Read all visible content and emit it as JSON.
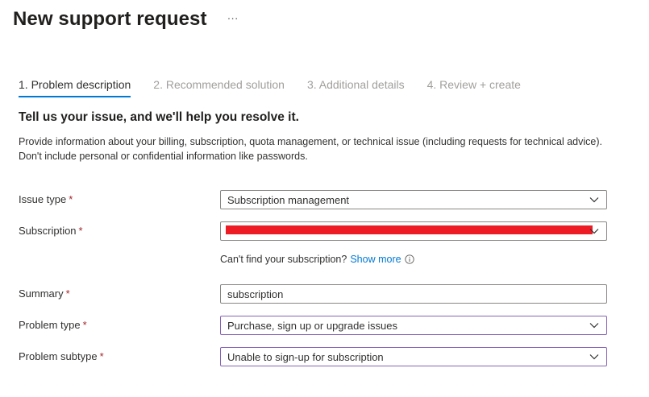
{
  "page": {
    "title": "New support request",
    "more_label": "···"
  },
  "tabs": [
    {
      "label": "1. Problem description",
      "active": true
    },
    {
      "label": "2. Recommended solution",
      "active": false
    },
    {
      "label": "3. Additional details",
      "active": false
    },
    {
      "label": "4. Review + create",
      "active": false
    }
  ],
  "intro": {
    "heading": "Tell us your issue, and we'll help you resolve it.",
    "description": "Provide information about your billing, subscription, quota management, or technical issue (including requests for technical advice). Don't include personal or confidential information like passwords."
  },
  "form": {
    "required_marker": "*",
    "issue_type": {
      "label": "Issue type",
      "value": "Subscription management"
    },
    "subscription": {
      "label": "Subscription",
      "value_redacted": true
    },
    "subscription_hint": {
      "text": "Can't find your subscription?",
      "link": "Show more",
      "icon": "info-icon"
    },
    "summary": {
      "label": "Summary",
      "value": "subscription"
    },
    "problem_type": {
      "label": "Problem type",
      "value": "Purchase, sign up or upgrade issues"
    },
    "problem_subtype": {
      "label": "Problem subtype",
      "value": "Unable to sign-up for subscription"
    }
  },
  "colors": {
    "accent": "#0078d4",
    "required": "#a4262c",
    "focus_border": "#8764b8",
    "redaction": "#ed1c24"
  }
}
